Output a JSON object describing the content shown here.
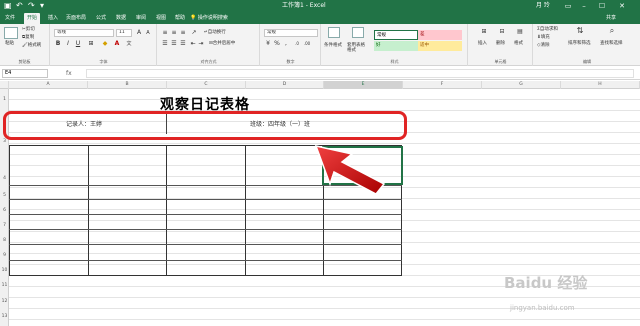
{
  "titlebar": {
    "title": "工作簿1 - Excel",
    "user": "月 玲",
    "minimize": "–",
    "maximize": "☐",
    "close": "✕",
    "ribbon_opts": "▭"
  },
  "tabs": [
    "文件",
    "开始",
    "插入",
    "页面布局",
    "公式",
    "数据",
    "审阅",
    "视图",
    "帮助"
  ],
  "tellme": "操作说明搜索",
  "share": "共享",
  "ribbon": {
    "clipboard": {
      "paste": "粘贴",
      "cut": "剪切",
      "copy": "复制",
      "painter": "格式刷",
      "label": "剪贴板"
    },
    "font": {
      "name": "等线",
      "size": "11",
      "label": "字体",
      "bold": "B",
      "italic": "I",
      "underline": "U",
      "font_color": "A"
    },
    "alignment": {
      "wrap": "自动换行",
      "merge": "合并后居中",
      "label": "对齐方式"
    },
    "number": {
      "format": "常规",
      "label": "数字"
    },
    "styles": {
      "conditional": "条件格式",
      "table": "套用表格格式",
      "label": "样式",
      "cells": [
        {
          "text": "常规",
          "bg": "#ffffff"
        },
        {
          "text": "差",
          "bg": "#ffc7ce"
        },
        {
          "text": "好",
          "bg": "#c6efce"
        },
        {
          "text": "适中",
          "bg": "#ffeb9c"
        }
      ]
    },
    "cells": {
      "insert": "插入",
      "delete": "删除",
      "format": "格式",
      "label": "单元格"
    },
    "editing": {
      "autosum": "自动求和",
      "fill": "填充",
      "clear": "清除",
      "sort": "排序和筛选",
      "find": "查找和选择",
      "label": "编辑"
    }
  },
  "formula_bar": {
    "name_box": "E4",
    "fx": "fx",
    "formula": ""
  },
  "columns": [
    "A",
    "B",
    "C",
    "D",
    "E",
    "F",
    "G",
    "H"
  ],
  "rows": [
    "1",
    "2",
    "3",
    "4",
    "5",
    "6",
    "7",
    "8",
    "9",
    "10",
    "11",
    "12",
    "13"
  ],
  "sheet": {
    "title": "观察日记表格",
    "recorder": "记录人：王婷",
    "class": "班级：四年级（一）班"
  },
  "watermark": {
    "brand": "Baidu 经验",
    "site": "jingyan.baidu.com"
  }
}
